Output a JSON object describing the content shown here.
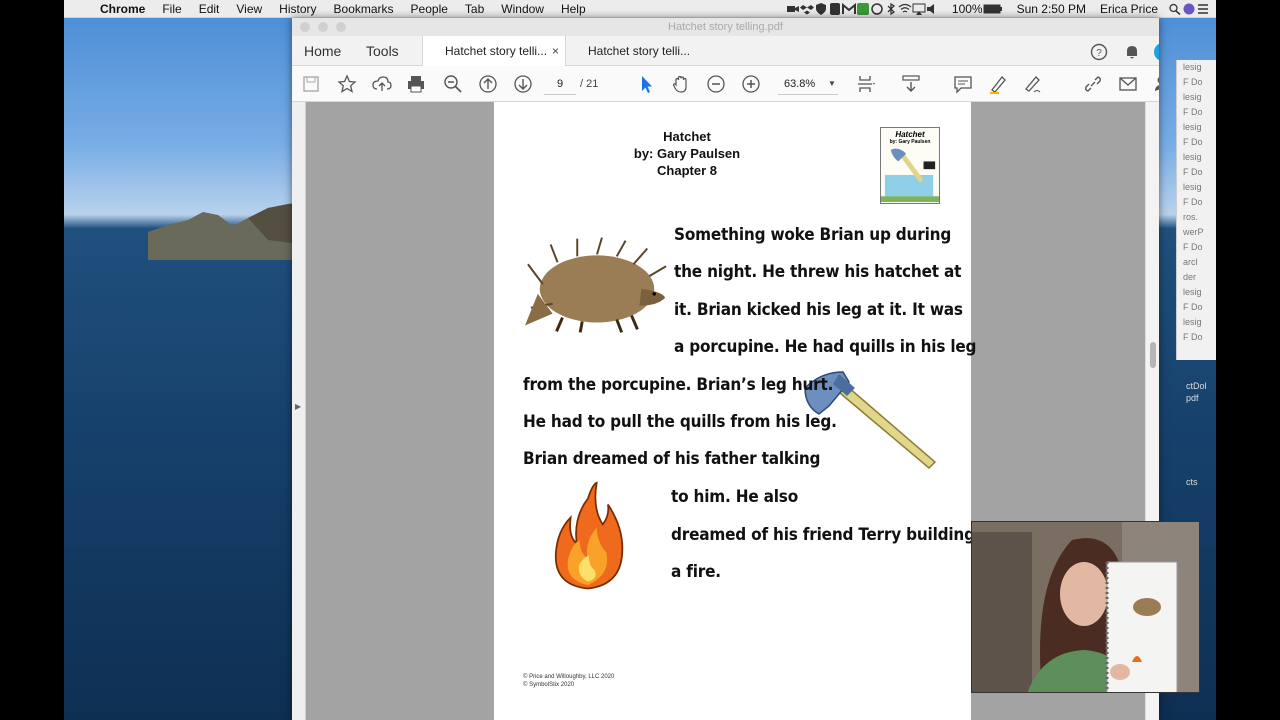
{
  "menubar": {
    "app": "Chrome",
    "items": [
      "File",
      "Edit",
      "View",
      "History",
      "Bookmarks",
      "People",
      "Tab",
      "Window",
      "Help"
    ],
    "battery": "100%",
    "clock": "Sun 2:50 PM",
    "user": "Erica Price"
  },
  "window": {
    "title": "Hatchet story telling.pdf"
  },
  "tabs": {
    "home": "Home",
    "tools": "Tools",
    "doc_tab_1": "Hatchet story telli...",
    "doc_tab_2": "Hatchet story telli..."
  },
  "toolbar": {
    "page_current": "9",
    "page_total": "/ 21",
    "zoom": "63.8%"
  },
  "document": {
    "heading": [
      "Hatchet",
      "by: Gary Paulsen",
      "Chapter 8"
    ],
    "cover_title": "Hatchet",
    "cover_author": "by: Gary Paulsen",
    "story_lines": [
      "Something woke Brian up during",
      "the night. He threw his hatchet at",
      "it. Brian kicked his leg at it. It was",
      "a porcupine. He had quills in his leg",
      "from the porcupine. Brian’s leg hurt.",
      "He had to pull the quills from his leg.",
      "Brian dreamed of his father talking",
      "to him. He also",
      "dreamed of his friend Terry building",
      "a fire."
    ],
    "copyright": [
      "© Price and Willoughby, LLC 2020",
      "© SymbolStix 2020"
    ]
  },
  "behind_window": {
    "rows": [
      "lesig",
      "F Do",
      "lesig",
      "F Do",
      "lesig",
      "F Do",
      "lesig",
      "F Do",
      "lesig",
      "F Do",
      "ros.",
      "werP",
      "F Do",
      "arcl",
      "der",
      "lesig",
      "F Do",
      "lesig",
      "F Do"
    ],
    "desktop_labels": [
      "ctDol",
      "pdf",
      "",
      "",
      "",
      "",
      "",
      "cts"
    ]
  }
}
